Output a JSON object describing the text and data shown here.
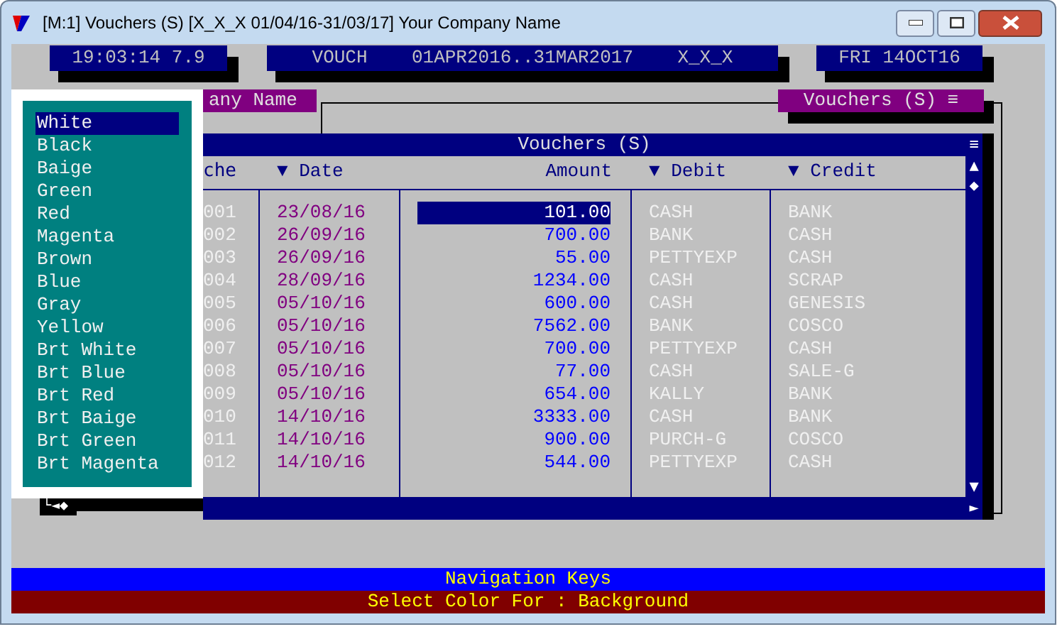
{
  "window": {
    "title": "[M:1]  Vouchers (S)  [X_X_X  01/04/16-31/03/17]  Your Company Name"
  },
  "status_boxes": [
    {
      "text": "19:03:14 7.9"
    },
    {
      "text": "VOUCH    01APR2016..31MAR2017    X_X_X"
    },
    {
      "text": "FRI 14OCT16"
    }
  ],
  "company_tab": "any Name",
  "window_label": "Vouchers (S) ≡",
  "table": {
    "title": "Vouchers (S)",
    "menu": "≡",
    "columns": [
      "che",
      "▼ Date",
      "Amount",
      "▼ Debit",
      "▼ Credit"
    ],
    "rows": [
      {
        "voucher": "001",
        "date": "23/08/16",
        "amount": "101.00",
        "debit": "CASH",
        "credit": "BANK",
        "selected": true
      },
      {
        "voucher": "002",
        "date": "26/09/16",
        "amount": "700.00",
        "debit": "BANK",
        "credit": "CASH",
        "selected": false
      },
      {
        "voucher": "003",
        "date": "26/09/16",
        "amount": "55.00",
        "debit": "PETTYEXP",
        "credit": "CASH",
        "selected": false
      },
      {
        "voucher": "004",
        "date": "28/09/16",
        "amount": "1234.00",
        "debit": "CASH",
        "credit": "SCRAP",
        "selected": false
      },
      {
        "voucher": "005",
        "date": "05/10/16",
        "amount": "600.00",
        "debit": "CASH",
        "credit": "GENESIS",
        "selected": false
      },
      {
        "voucher": "006",
        "date": "05/10/16",
        "amount": "7562.00",
        "debit": "BANK",
        "credit": "COSCO",
        "selected": false
      },
      {
        "voucher": "007",
        "date": "05/10/16",
        "amount": "700.00",
        "debit": "PETTYEXP",
        "credit": "CASH",
        "selected": false
      },
      {
        "voucher": "008",
        "date": "05/10/16",
        "amount": "77.00",
        "debit": "CASH",
        "credit": "SALE-G",
        "selected": false
      },
      {
        "voucher": "009",
        "date": "05/10/16",
        "amount": "654.00",
        "debit": "KALLY",
        "credit": "BANK",
        "selected": false
      },
      {
        "voucher": "010",
        "date": "14/10/16",
        "amount": "3333.00",
        "debit": "CASH",
        "credit": "BANK",
        "selected": false
      },
      {
        "voucher": "011",
        "date": "14/10/16",
        "amount": "900.00",
        "debit": "PURCH-G",
        "credit": "COSCO",
        "selected": false
      },
      {
        "voucher": "012",
        "date": "14/10/16",
        "amount": "544.00",
        "debit": "PETTYEXP",
        "credit": "CASH",
        "selected": false
      }
    ],
    "scroll": {
      "up": "▲",
      "thumb": "◆",
      "down": "▼",
      "right": "►"
    }
  },
  "corner_mark": "└◄◆",
  "color_menu": {
    "items": [
      {
        "label": "White",
        "selected": true
      },
      {
        "label": "Black",
        "selected": false
      },
      {
        "label": "Baige",
        "selected": false
      },
      {
        "label": "Green",
        "selected": false
      },
      {
        "label": "Red",
        "selected": false
      },
      {
        "label": "Magenta",
        "selected": false
      },
      {
        "label": "Brown",
        "selected": false
      },
      {
        "label": "Blue",
        "selected": false
      },
      {
        "label": "Gray",
        "selected": false
      },
      {
        "label": "Yellow",
        "selected": false
      },
      {
        "label": "Brt White",
        "selected": false
      },
      {
        "label": "Brt Blue",
        "selected": false
      },
      {
        "label": "Brt Red",
        "selected": false
      },
      {
        "label": "Brt Baige",
        "selected": false
      },
      {
        "label": "Brt Green",
        "selected": false
      },
      {
        "label": "Brt Magenta",
        "selected": false
      }
    ]
  },
  "footer": {
    "navigation": "Navigation Keys",
    "prompt": "Select Color For : Background"
  }
}
